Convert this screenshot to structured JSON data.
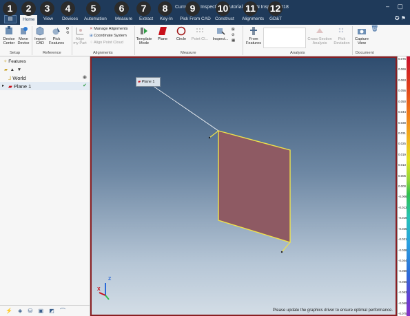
{
  "window": {
    "title": "Cumulative Inspection - Tutorial * - PAN Inspect 2018",
    "controls": [
      "–",
      "▢"
    ]
  },
  "tour_badges": [
    "1",
    "2",
    "3",
    "4",
    "5",
    "6",
    "7",
    "8",
    "9",
    "10",
    "11",
    "12"
  ],
  "tabs": [
    "Home",
    "View",
    "Devices",
    "Automation",
    "Measure",
    "Extract",
    "Key-In",
    "Pick From CAD",
    "Construct",
    "Alignments",
    "GD&T"
  ],
  "active_tab": "Home",
  "ribbon": {
    "setup": {
      "label": "Setup",
      "device_center": "Device Center",
      "move_device": "Move Device"
    },
    "reference": {
      "label": "Reference",
      "import_cad": "Import CAD",
      "pick_features": "Pick Features"
    },
    "alignments": {
      "label": "Alignments",
      "align_my_part": "Align my Part",
      "manage_alignments": "Manage Alignments",
      "coordinate_system": "Coordinate System",
      "align_point_cloud": "Align Point Cloud"
    },
    "measure": {
      "label": "Measure",
      "template_mode": "Template Mode",
      "plane": "Plane",
      "circle": "Circle",
      "point_cloud": "Point Cl...",
      "inspect": "Inspect..."
    },
    "analysis": {
      "label": "Analysis",
      "from_features": "From Features",
      "cross_section": "Cross-Section Analysis",
      "pick_deviation": "Pick Deviation"
    },
    "document": {
      "label": "Document",
      "capture_view": "Capture View"
    }
  },
  "features_panel": {
    "title": "Features",
    "items": [
      {
        "label": "World",
        "status": "◉"
      },
      {
        "label": "Plane 1",
        "status": "✔"
      }
    ]
  },
  "viewport": {
    "plane_label": "Plane 1",
    "status_message": "Please update the graphics driver to ensure optimal performance.",
    "axes": {
      "x": "X",
      "z": "Z"
    }
  },
  "color_scale": {
    "labels": [
      "0.075",
      "0.069",
      "0.063",
      "0.056",
      "0.050",
      "0.044",
      "0.038",
      "0.031",
      "0.025",
      "0.019",
      "0.013",
      "0.006",
      "0.000",
      "-0.006",
      "-0.013",
      "-0.019",
      "-0.025",
      "-0.031",
      "-0.038",
      "-0.044",
      "-0.050",
      "-0.056",
      "-0.063",
      "-0.069",
      "-0.075"
    ],
    "colors": {
      "top": "#c8102e",
      "mid": "#2fbf4d",
      "bottom": "#8a33c5"
    }
  }
}
